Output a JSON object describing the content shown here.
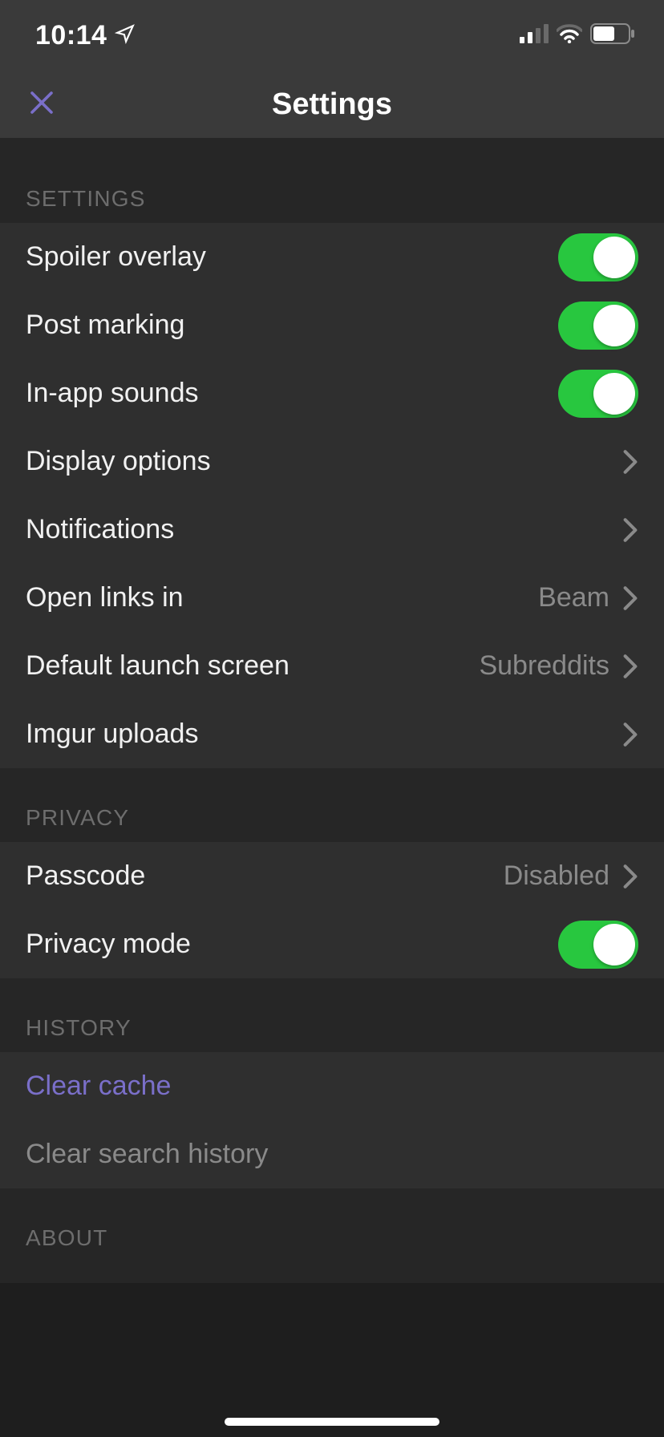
{
  "statusbar": {
    "time": "10:14"
  },
  "nav": {
    "title": "Settings"
  },
  "sections": {
    "settings": {
      "header": "SETTINGS",
      "spoiler_overlay": {
        "label": "Spoiler overlay",
        "on": true
      },
      "post_marking": {
        "label": "Post marking",
        "on": true
      },
      "in_app_sounds": {
        "label": "In-app sounds",
        "on": true
      },
      "display_options": {
        "label": "Display options"
      },
      "notifications": {
        "label": "Notifications"
      },
      "open_links_in": {
        "label": "Open links in",
        "value": "Beam"
      },
      "default_launch_screen": {
        "label": "Default launch screen",
        "value": "Subreddits"
      },
      "imgur_uploads": {
        "label": "Imgur uploads"
      }
    },
    "privacy": {
      "header": "PRIVACY",
      "passcode": {
        "label": "Passcode",
        "value": "Disabled"
      },
      "privacy_mode": {
        "label": "Privacy mode",
        "on": true
      }
    },
    "history": {
      "header": "HISTORY",
      "clear_cache": {
        "label": "Clear cache"
      },
      "clear_search_history": {
        "label": "Clear search history"
      }
    },
    "about": {
      "header": "ABOUT"
    }
  }
}
